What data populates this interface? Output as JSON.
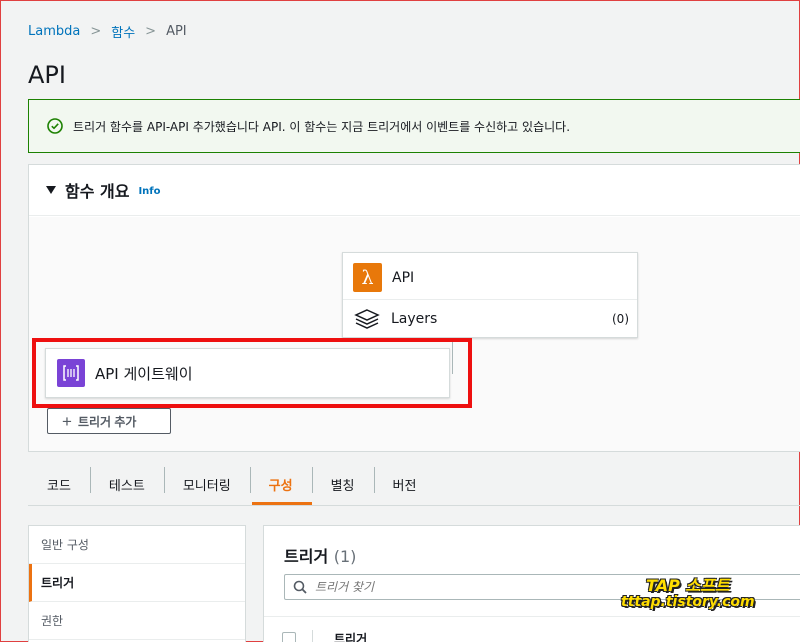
{
  "breadcrumb": {
    "items": [
      "Lambda",
      "함수",
      "API"
    ]
  },
  "page": {
    "title": "API"
  },
  "flash": {
    "message": "트리거 함수를 API-API 추가했습니다 API. 이 함수는 지금 트리거에서 이벤트를 수신하고 있습니다."
  },
  "overview": {
    "title": "함수 개요",
    "info": "Info",
    "function": {
      "name": "API",
      "layers_label": "Layers",
      "layers_count": "(0)"
    },
    "trigger": {
      "name": "API 게이트웨이"
    },
    "add_trigger_label": "트리거 추가"
  },
  "tabs": [
    {
      "label": "코드"
    },
    {
      "label": "테스트"
    },
    {
      "label": "모니터링"
    },
    {
      "label": "구성",
      "active": true
    },
    {
      "label": "별칭"
    },
    {
      "label": "버전"
    }
  ],
  "sidenav": {
    "items": [
      "일반 구성",
      "트리거",
      "권한"
    ],
    "active": "트리거"
  },
  "triggers_panel": {
    "title": "트리거",
    "count": "(1)",
    "search_placeholder": "트리거 찾기",
    "column_header": "트리거"
  },
  "watermark": {
    "line1": "TAP 소프트",
    "line2": "tttap.tistory.com"
  },
  "colors": {
    "accent": "#ec7211",
    "link": "#0073bb",
    "success": "#1d8102",
    "highlight": "#ee1010",
    "lambda": "#e8780a",
    "apigw": "#7a43d6"
  }
}
